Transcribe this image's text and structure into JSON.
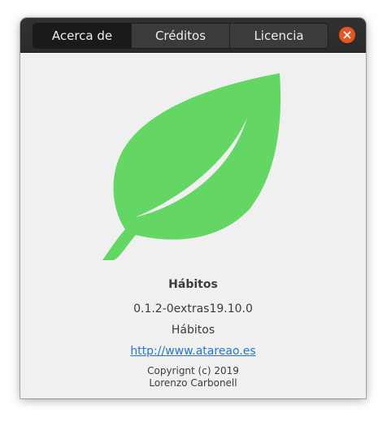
{
  "tabs": [
    {
      "label": "Acerca de",
      "active": true
    },
    {
      "label": "Créditos",
      "active": false
    },
    {
      "label": "Licencia",
      "active": false
    }
  ],
  "close_icon": "close-icon",
  "app": {
    "logo_icon": "leaf-icon",
    "logo_color": "#63d663",
    "name": "Hábitos",
    "version": "0.1.2-0extras19.10.0",
    "comments": "Hábitos",
    "website": "http://www.atareao.es",
    "copyright_lines": [
      "Copyrignt (c) 2019",
      "Lorenzo Carbonell"
    ]
  },
  "colors": {
    "header_bg": "#2d2d2d",
    "close_button": "#e95420",
    "link": "#2a76c6",
    "content_bg": "#f0f0f0"
  }
}
